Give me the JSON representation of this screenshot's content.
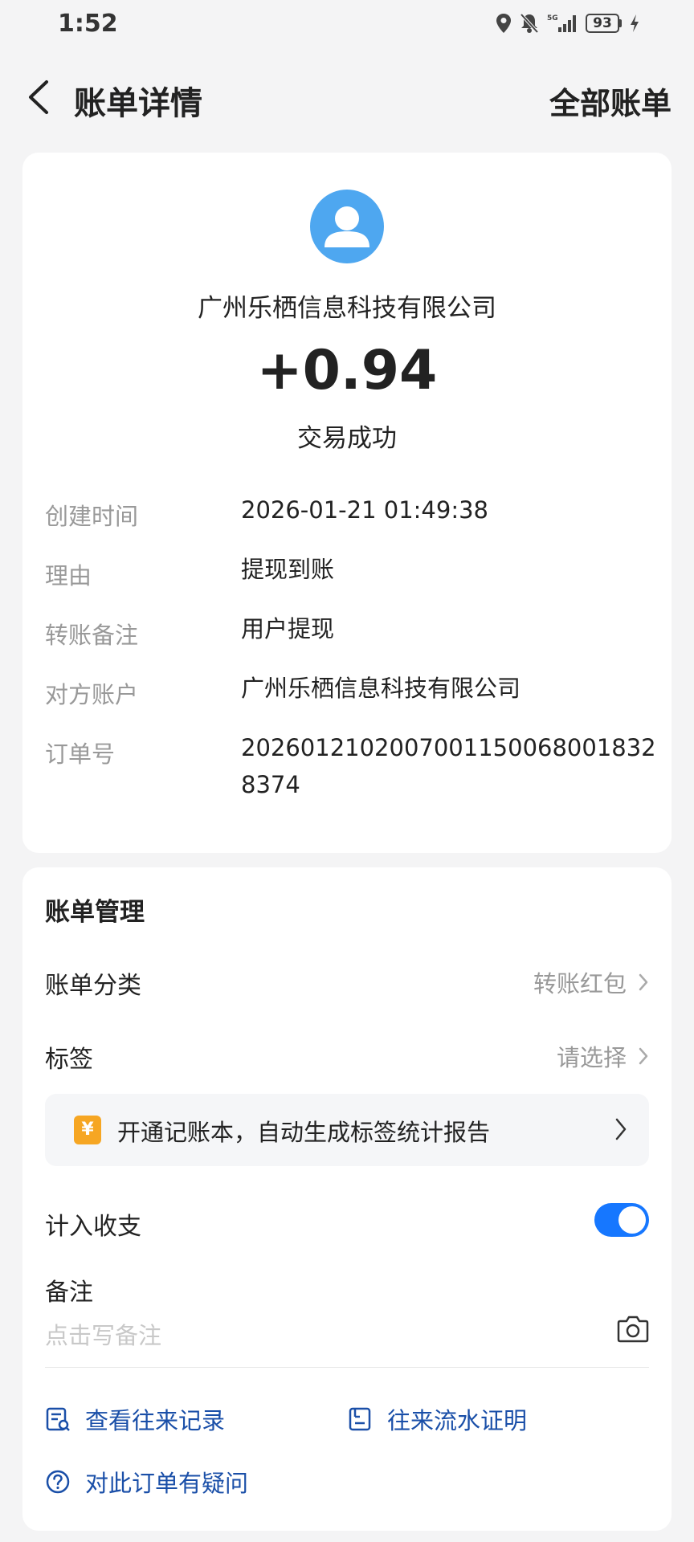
{
  "status_bar": {
    "time": "1:52",
    "network": "5G",
    "battery": "93",
    "icons": [
      "location-icon",
      "mute-icon",
      "signal-icon",
      "battery-icon",
      "charging-icon"
    ]
  },
  "header": {
    "back_icon": "chevron-left-icon",
    "title": "账单详情",
    "right_link": "全部账单"
  },
  "summary": {
    "avatar_icon": "user-icon",
    "counterparty": "广州乐栖信息科技有限公司",
    "amount": "+0.94",
    "status": "交易成功"
  },
  "details": [
    {
      "label": "创建时间",
      "value": "2026-01-21 01:49:38"
    },
    {
      "label": "理由",
      "value": "提现到账"
    },
    {
      "label": "转账备注",
      "value": "用户提现"
    },
    {
      "label": "对方账户",
      "value": "广州乐栖信息科技有限公司"
    },
    {
      "label": "订单号",
      "value": "20260121020070011500680018328374"
    }
  ],
  "manage": {
    "title": "账单管理",
    "category": {
      "label": "账单分类",
      "value": "转账红包"
    },
    "tag": {
      "label": "标签",
      "value": "请选择"
    },
    "promo": {
      "icon": "¥",
      "text": "开通记账本，自动生成标签统计报告"
    },
    "include": {
      "label": "计入收支",
      "enabled": true
    },
    "note": {
      "label": "备注",
      "placeholder": "点击写备注"
    },
    "links": {
      "history": "查看往来记录",
      "proof": "往来流水证明",
      "question": "对此订单有疑问"
    }
  },
  "colors": {
    "accent": "#1677ff",
    "link": "#1a4fa8",
    "avatar": "#4ea7f0",
    "promo_icon": "#f6a623",
    "background": "#f4f4f5"
  }
}
